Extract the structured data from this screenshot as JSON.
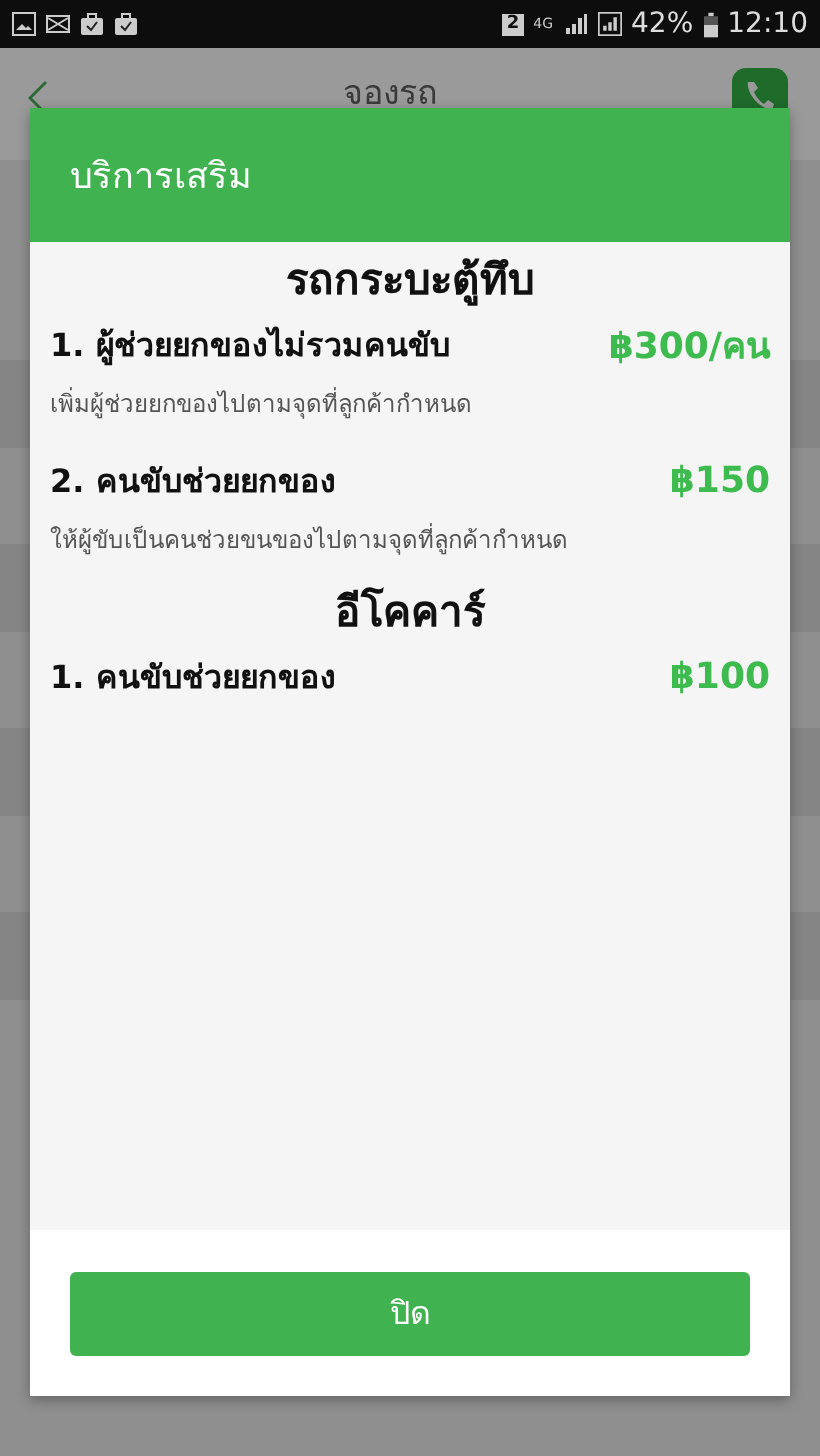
{
  "status_bar": {
    "sim": "2",
    "network": "4G",
    "battery": "42%",
    "time": "12:10"
  },
  "app_bar": {
    "title": "จองรถ"
  },
  "dialog": {
    "title": "บริการเสริม",
    "sections": [
      {
        "heading": "รถกระบะตู้ทึบ",
        "items": [
          {
            "name": "1. ผู้ช่วยยกของไม่รวมคนขับ",
            "price": "฿300/คน",
            "description": "เพิ่มผู้ช่วยยกของไปตามจุดที่ลูกค้ากำหนด"
          },
          {
            "name": "2. คนขับช่วยยกของ",
            "price": "฿150",
            "description": "ให้ผู้ขับเป็นคนช่วยขนของไปตามจุดที่ลูกค้ากำหนด"
          }
        ]
      },
      {
        "heading": "อีโคคาร์",
        "items": [
          {
            "name": "1. คนขับช่วยยกของ",
            "price": "฿100"
          }
        ]
      }
    ],
    "close_button": "ปิด"
  }
}
